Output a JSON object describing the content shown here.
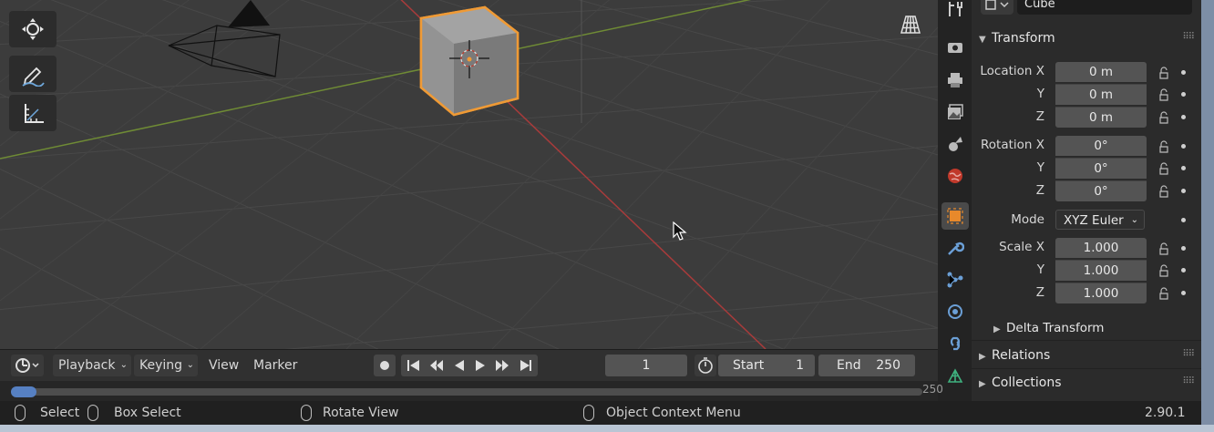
{
  "viewport": {
    "tools": [
      "move-tool",
      "annotate-tool",
      "measure-tool"
    ]
  },
  "properties": {
    "object_name": "Cube",
    "transform": {
      "title": "Transform",
      "location_label": "Location X",
      "location": [
        "0 m",
        "0 m",
        "0 m"
      ],
      "rotation_label": "Rotation X",
      "rotation": [
        "0°",
        "0°",
        "0°"
      ],
      "mode_label": "Mode",
      "mode_value": "XYZ Euler",
      "scale_label": "Scale X",
      "scale": [
        "1.000",
        "1.000",
        "1.000"
      ],
      "y_label": "Y",
      "z_label": "Z"
    },
    "delta_transform": "Delta Transform",
    "relations": "Relations",
    "collections": "Collections"
  },
  "timeline": {
    "playback": "Playback",
    "keying": "Keying",
    "view": "View",
    "marker": "Marker",
    "current_frame": "1",
    "start_label": "Start",
    "start_value": "1",
    "end_label": "End",
    "end_value": "250",
    "end_tick": "250"
  },
  "status": {
    "select": "Select",
    "box_select": "Box Select",
    "rotate_view": "Rotate View",
    "context_menu": "Object Context Menu",
    "version": "2.90.1"
  },
  "colors": {
    "accent": "#e8892b",
    "x_axis": "#a83b3b",
    "y_axis": "#7a9a3c",
    "active_tab": "#4a4a4a"
  }
}
